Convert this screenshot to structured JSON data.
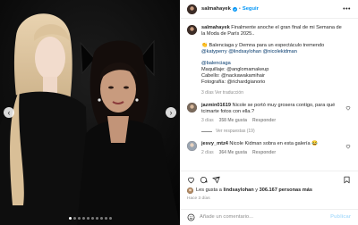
{
  "post": {
    "author": "salmahayek",
    "separator": "•",
    "follow_label": "Seguir",
    "more_label": "•••",
    "caption": {
      "line1": "Finalmente anoche el gran final de mi Semana de",
      "line2": "la Moda de París 2025..",
      "line3": "👏 Balenciaga y Demna para un espectáculo tremendo",
      "line4": "@katyperry @lindsaylohan @nicolekidman",
      "line5": "@balenciaga",
      "line6": "Maquillaje: @anglomamakeup",
      "line7": "Cabello: @nackawakamihair",
      "line8": "Fotografía: @richardgianorio",
      "meta": "3 días   Ver traducción"
    },
    "comments": [
      {
        "user": "jazmin01619",
        "text": "Nicole se portó muy grosera contigo, para qué",
        "text2": "tcimarte fotos con ella.?",
        "time": "3 días",
        "likes": "358 Me gusta",
        "reply": "Responder",
        "view_replies": "Ver respuestas (19)"
      },
      {
        "user": "jesvy_mtz4",
        "text": "Nicole Kidman sobra en esta galería 😂",
        "time": "2 días",
        "likes": "364 Me gusta",
        "reply": "Responder"
      }
    ],
    "likes_prefix": "Les gusta a ",
    "likes_user": "lindsaylohan",
    "likes_middle": " y ",
    "likes_count": "306.167 personas más",
    "date": "Hace 3 días",
    "comment_placeholder": "Añade un comentario...",
    "publish_label": "Publicar"
  },
  "carousel": {
    "slides": 10,
    "active_index": 0
  },
  "colors": {
    "accent": "#0095f6",
    "link": "#00376b",
    "muted": "#8e8e8e"
  }
}
